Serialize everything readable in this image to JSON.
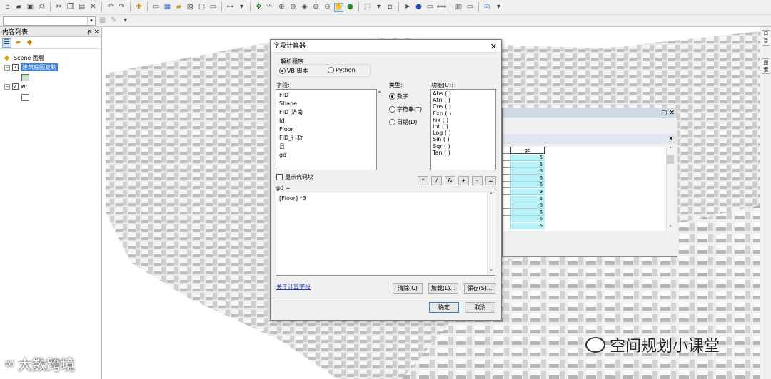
{
  "toolbar": {
    "icons": [
      "new-icon",
      "open-icon",
      "save-icon",
      "print-icon",
      "cut-icon",
      "copy-icon",
      "paste-icon",
      "delete-icon",
      "undo-icon",
      "redo-icon",
      "add-data-icon",
      "layout-icon",
      "navigate-icon",
      "pan-icon",
      "zoom-in-icon",
      "zoom-out-icon",
      "full-extent-icon",
      "identify-icon",
      "select-icon",
      "info-icon",
      "help-icon"
    ]
  },
  "toc": {
    "title": "内容列表",
    "pin": "ᵽ ×",
    "scene_label": "Scene 图层",
    "layer1": "建筑底图复制",
    "layer2": "wr"
  },
  "dialog": {
    "title": "字段计算器",
    "parser_label": "解析程序",
    "parser_vb": "VB 脚本",
    "parser_python": "Python",
    "fields_label": "字段:",
    "fields": [
      "FID",
      "Shape",
      "FID_济南",
      "Id",
      "Floor",
      "FID_行政",
      "县",
      "gd"
    ],
    "type_label": "类型:",
    "type_number": "数字",
    "type_string": "字符串(T)",
    "type_date": "日期(D)",
    "functions_label": "功能(U):",
    "functions": [
      "Abs ( )",
      "Atn ( )",
      "Cos ( )",
      "Exp ( )",
      "Fix ( )",
      "Int ( )",
      "Log ( )",
      "Sin ( )",
      "Sqr ( )",
      "Tan ( )"
    ],
    "show_codeblock": "显示代码块",
    "operators": [
      "*",
      "/",
      "&",
      "+",
      "-",
      "="
    ],
    "expression_label": "gd =",
    "expression": "[Floor] *3",
    "about_link": "关于计算字段",
    "clear_btn": "清除(C)",
    "load_btn": "加载(L)...",
    "save_btn": "保存(S)...",
    "ok_btn": "确定",
    "cancel_btn": "取消"
  },
  "table": {
    "column_header": "gd",
    "values": [
      "6",
      "6",
      "6",
      "6",
      "6",
      "9",
      "6",
      "6",
      "6",
      "6",
      "6"
    ]
  },
  "watermarks": {
    "left": "大数跨境",
    "right": "空间规划小课堂"
  }
}
